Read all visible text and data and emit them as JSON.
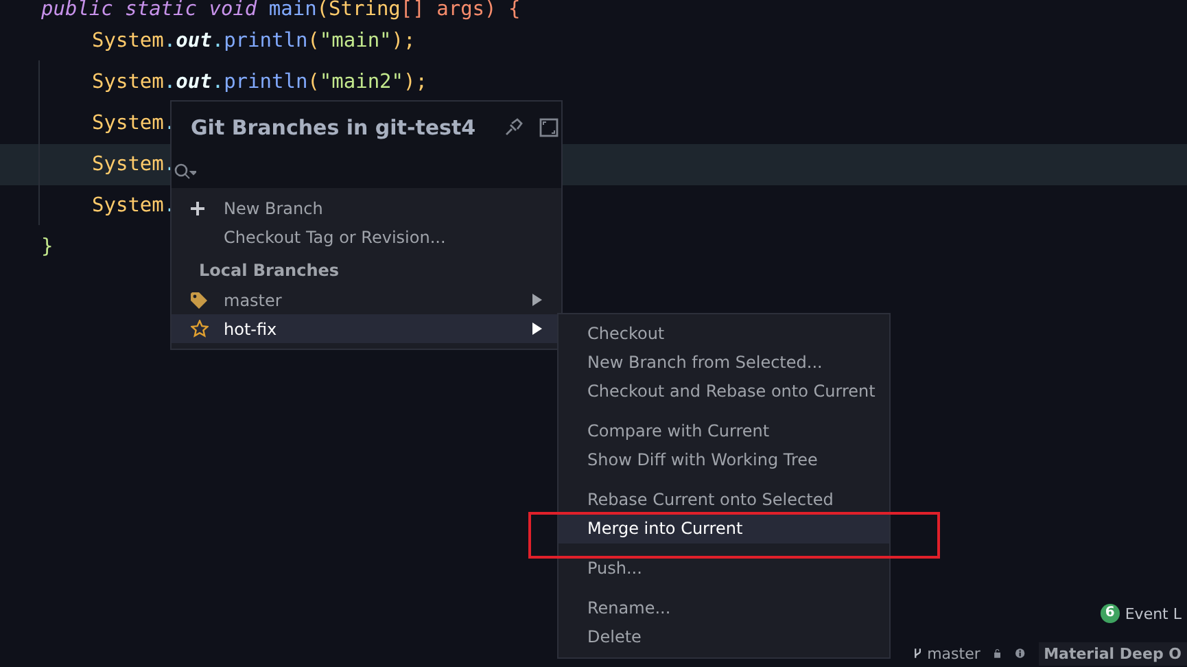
{
  "editor": {
    "lines": [
      {
        "current": false,
        "segments": [
          {
            "text": "public static void ",
            "kind": "keyword"
          },
          {
            "text": "main",
            "kind": "method"
          },
          {
            "text": "(",
            "kind": "punct"
          },
          {
            "text": "String",
            "kind": "type"
          },
          {
            "text": "[] args) {",
            "kind": "param"
          }
        ]
      },
      {
        "current": false,
        "segments": [
          {
            "text": "System",
            "kind": "type"
          },
          {
            "text": ".",
            "kind": "dot"
          },
          {
            "text": "out",
            "kind": "field"
          },
          {
            "text": ".",
            "kind": "dot"
          },
          {
            "text": "println",
            "kind": "method"
          },
          {
            "text": "(",
            "kind": "punct"
          },
          {
            "text": "\"main\"",
            "kind": "string"
          },
          {
            "text": ");",
            "kind": "punct"
          }
        ]
      },
      {
        "current": false,
        "segments": [
          {
            "text": "System",
            "kind": "type"
          },
          {
            "text": ".",
            "kind": "dot"
          },
          {
            "text": "out",
            "kind": "field"
          },
          {
            "text": ".",
            "kind": "dot"
          },
          {
            "text": "println",
            "kind": "method"
          },
          {
            "text": "(",
            "kind": "punct"
          },
          {
            "text": "\"main2\"",
            "kind": "string"
          },
          {
            "text": ");",
            "kind": "punct"
          }
        ]
      },
      {
        "current": false,
        "segments": [
          {
            "text": "System",
            "kind": "type"
          },
          {
            "text": ".",
            "kind": "dot"
          }
        ]
      },
      {
        "current": true,
        "segments": [
          {
            "text": "System",
            "kind": "type"
          },
          {
            "text": ".",
            "kind": "dot"
          }
        ]
      },
      {
        "current": false,
        "segments": [
          {
            "text": "System",
            "kind": "type"
          },
          {
            "text": ".",
            "kind": "dot"
          }
        ]
      },
      {
        "current": false,
        "segments": [
          {
            "text": "}",
            "kind": "brace"
          }
        ]
      }
    ]
  },
  "branches_popup": {
    "title": "Git Branches in git-test4",
    "actions": [
      {
        "label": "New Branch",
        "kind": "plus"
      },
      {
        "label": "Checkout Tag or Revision...",
        "kind": "plain"
      }
    ],
    "section": "Local Branches",
    "branches": [
      {
        "name": "master",
        "kind": "tag",
        "selected": false
      },
      {
        "name": "hot-fix",
        "kind": "star",
        "selected": true
      }
    ]
  },
  "branch_menu": {
    "groups": [
      [
        {
          "label": "Checkout",
          "selected": false
        },
        {
          "label": "New Branch from Selected...",
          "selected": false
        },
        {
          "label": "Checkout and Rebase onto Current",
          "selected": false
        }
      ],
      [
        {
          "label": "Compare with Current",
          "selected": false
        },
        {
          "label": "Show Diff with Working Tree",
          "selected": false
        }
      ],
      [
        {
          "label": "Rebase Current onto Selected",
          "selected": false
        },
        {
          "label": "Merge into Current",
          "selected": true
        }
      ],
      [
        {
          "label": "Push...",
          "selected": false
        }
      ],
      [
        {
          "label": "Rename...",
          "selected": false
        },
        {
          "label": "Delete",
          "selected": false
        }
      ]
    ]
  },
  "event_log": {
    "count": "6",
    "label": "Event L"
  },
  "status_bar": {
    "branch": "master",
    "theme": "Material Deep O"
  }
}
